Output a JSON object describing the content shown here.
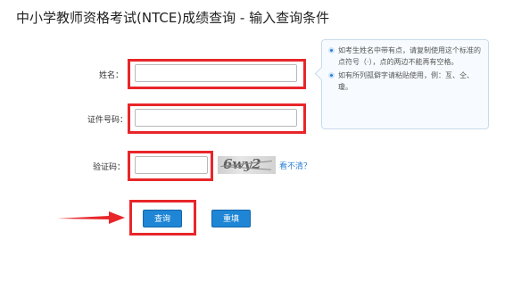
{
  "page": {
    "title": "中小学教师资格考试(NTCE)成绩查询 - 输入查询条件"
  },
  "form": {
    "name_label": "姓名：",
    "name_value": "",
    "id_label": "证件号码：",
    "id_value": "",
    "captcha_label": "验证码：",
    "captcha_value": "",
    "captcha_text": "6wy2",
    "captcha_refresh_link": "看不清？",
    "submit_label": "查询",
    "reset_label": "重填"
  },
  "tips": [
    "如考生姓名中带有点，请复制使用这个标准的点符号（·），点的两边不能再有空格。",
    "如有所列孤僻字请粘贴使用，例：亙、仝、瓊。"
  ],
  "colors": {
    "highlight": "#e8262a",
    "button": "#1f86d6",
    "link": "#2b7fd1",
    "tip_border": "#c9daea"
  }
}
